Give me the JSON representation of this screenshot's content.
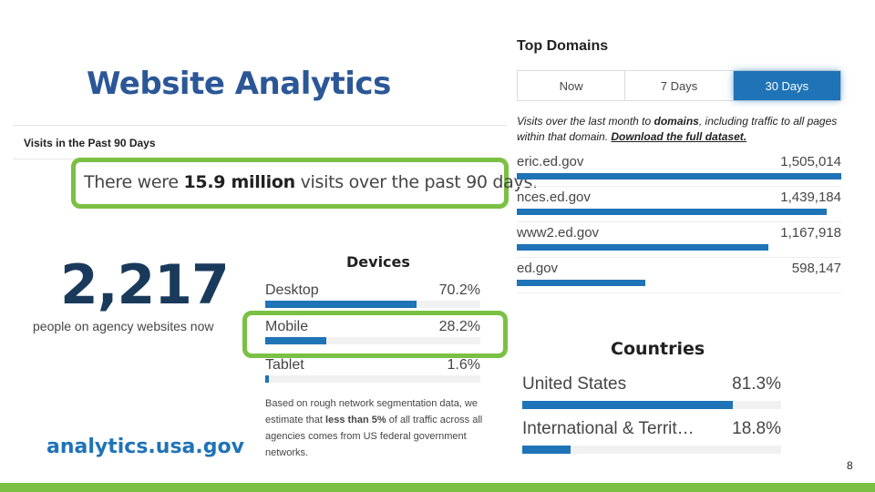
{
  "slide": {
    "title": "Website Analytics",
    "footer_link": "analytics.usa.gov",
    "page_number": "8",
    "accent_green": "#7ac143",
    "accent_blue": "#1f73b7"
  },
  "visits": {
    "header": "Visits in the Past 90 Days",
    "prefix": "There were ",
    "highlight": "15.9 million",
    "suffix": " visits over the past 90 days."
  },
  "realtime": {
    "number": "2,217",
    "caption": "people on agency websites now"
  },
  "devices": {
    "title": "Devices",
    "items": [
      {
        "label": "Desktop",
        "percent_text": "70.2%",
        "value": 70.2
      },
      {
        "label": "Mobile",
        "percent_text": "28.2%",
        "value": 28.2
      },
      {
        "label": "Tablet",
        "percent_text": "1.6%",
        "value": 1.6
      }
    ],
    "note_prefix": "Based on rough network segmentation data, we estimate that ",
    "note_highlight": "less than 5%",
    "note_suffix": " of all traffic across all agencies comes from US federal government networks."
  },
  "top_domains": {
    "title": "Top Domains",
    "tabs": [
      {
        "label": "Now",
        "active": false
      },
      {
        "label": "7 Days",
        "active": false
      },
      {
        "label": "30 Days",
        "active": true
      }
    ],
    "desc_prefix": "Visits over the last month to ",
    "desc_bold": "domains",
    "desc_middle": ", including traffic to all pages within that domain. ",
    "desc_link": "Download the full dataset.",
    "items": [
      {
        "domain": "eric.ed.gov",
        "visits_text": "1,505,014",
        "visits": 1505014
      },
      {
        "domain": "nces.ed.gov",
        "visits_text": "1,439,184",
        "visits": 1439184
      },
      {
        "domain": "www2.ed.gov",
        "visits_text": "1,167,918",
        "visits": 1167918
      },
      {
        "domain": "ed.gov",
        "visits_text": "598,147",
        "visits": 598147
      }
    ]
  },
  "countries": {
    "title": "Countries",
    "items": [
      {
        "label": "United States",
        "percent_text": "81.3%",
        "value": 81.3
      },
      {
        "label": "International & Territ…",
        "percent_text": "18.8%",
        "value": 18.8
      }
    ]
  }
}
